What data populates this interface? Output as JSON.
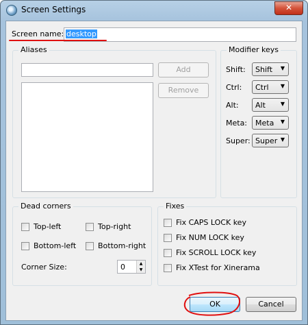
{
  "window": {
    "title": "Screen Settings",
    "close_glyph": "✕"
  },
  "screen_name": {
    "label": "Screen name:",
    "value": "desktop"
  },
  "aliases": {
    "group_title": "Aliases",
    "input_value": "",
    "add_label": "Add",
    "remove_label": "Remove"
  },
  "modifier_keys": {
    "group_title": "Modifier keys",
    "rows": [
      {
        "label": "Shift:",
        "value": "Shift"
      },
      {
        "label": "Ctrl:",
        "value": "Ctrl"
      },
      {
        "label": "Alt:",
        "value": "Alt"
      },
      {
        "label": "Meta:",
        "value": "Meta"
      },
      {
        "label": "Super:",
        "value": "Super"
      }
    ]
  },
  "dead_corners": {
    "group_title": "Dead corners",
    "top_left": "Top-left",
    "top_right": "Top-right",
    "bottom_left": "Bottom-left",
    "bottom_right": "Bottom-right",
    "corner_size_label": "Corner Size:",
    "corner_size_value": "0"
  },
  "fixes": {
    "group_title": "Fixes",
    "items": [
      "Fix CAPS LOCK key",
      "Fix NUM LOCK key",
      "Fix SCROLL LOCK key",
      "Fix XTest for Xinerama"
    ]
  },
  "buttons": {
    "ok": "OK",
    "cancel": "Cancel"
  },
  "dropdown_arrow": "▼",
  "spin_up": "▲",
  "spin_down": "▼"
}
